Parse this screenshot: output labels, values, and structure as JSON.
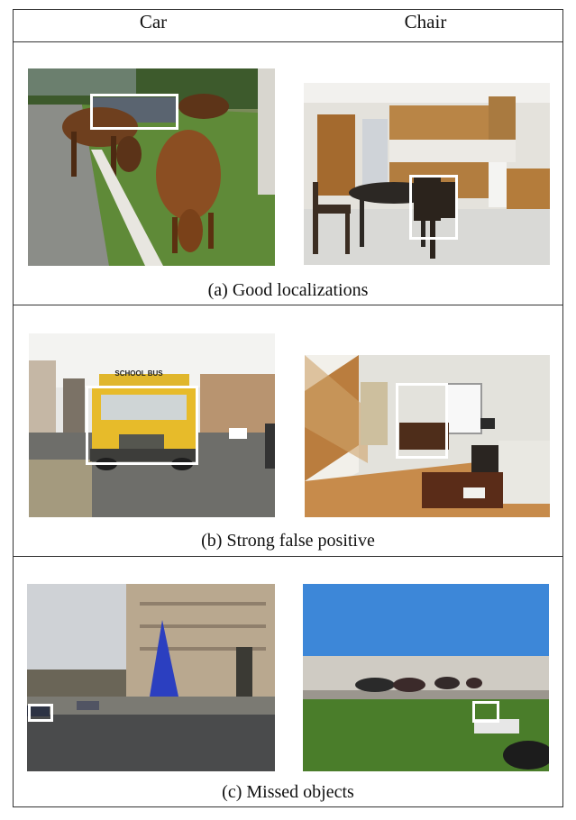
{
  "header": {
    "col_left": "Car",
    "col_right": "Chair"
  },
  "rows": [
    {
      "caption": "(a) Good localizations"
    },
    {
      "caption": "(b) Strong false positive"
    },
    {
      "caption": "(c) Missed objects"
    }
  ],
  "signs": {
    "bus_sign": "SCHOOL BUS"
  },
  "colors": {
    "box": "#ffffff",
    "border": "#333333"
  }
}
